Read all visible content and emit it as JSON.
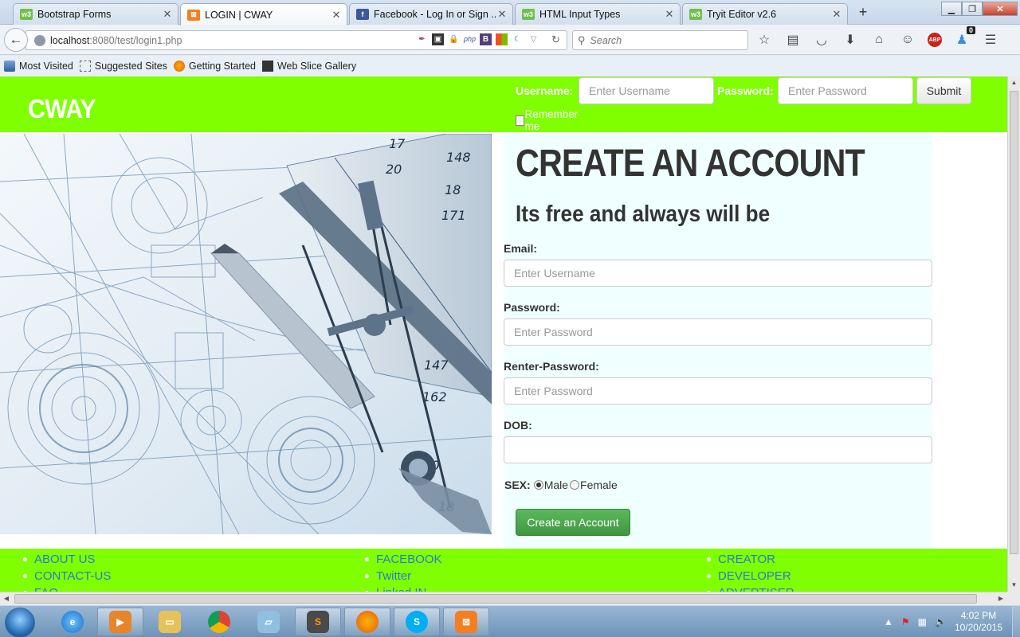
{
  "browser": {
    "tabs": [
      {
        "title": "Bootstrap Forms",
        "fav": "w3",
        "color": "#6ec04b",
        "active": false
      },
      {
        "title": "LOGIN | CWAY",
        "fav": "xampp",
        "color": "#f57e20",
        "active": true
      },
      {
        "title": "Facebook - Log In or Sign ...",
        "fav": "f",
        "color": "#3b5998",
        "active": false
      },
      {
        "title": "HTML Input Types",
        "fav": "w3",
        "color": "#6ec04b",
        "active": false
      },
      {
        "title": "Tryit Editor v2.6",
        "fav": "w3",
        "color": "#6ec04b",
        "active": false
      }
    ],
    "new_tab": "+",
    "url_host": "localhost",
    "url_rest": ":8080/test/login1.php",
    "search_placeholder": "Search",
    "bookmarks": [
      "Most Visited",
      "Suggested Sites",
      "Getting Started",
      "Web Slice Gallery"
    ],
    "notification_count": "0"
  },
  "site": {
    "logo": "CWAY",
    "login": {
      "username_label": "Username:",
      "username_placeholder": "Enter Username",
      "password_label": "Password:",
      "password_placeholder": "Enter Password",
      "submit_label": "Submit",
      "remember_label": "Remember me"
    },
    "signup": {
      "title": "CREATE AN ACCOUNT",
      "subtitle": "Its free and always will be",
      "email_label": "Email:",
      "email_placeholder": "Enter Username",
      "password_label": "Password:",
      "password_placeholder": "Enter Password",
      "repassword_label": "Renter-Password:",
      "repassword_placeholder": "Enter Password",
      "dob_label": "DOB:",
      "sex_label": "SEX:",
      "sex_options": [
        "Male",
        "Female"
      ],
      "sex_selected": "Male",
      "create_label": "Create an Account"
    },
    "footer": {
      "col1": [
        "ABOUT US",
        "CONTACT-US",
        "FAQ"
      ],
      "col2": [
        "FACEBOOK",
        "Twitter",
        "Linked IN"
      ],
      "col3": [
        "CREATOR",
        "DEVELOPER",
        "ADVERTISER"
      ]
    },
    "colors": {
      "header_green": "#7fff00",
      "panel_bg": "#f0ffff",
      "link_blue": "#2a7ad2",
      "create_green": "#5cb85c"
    }
  },
  "taskbar": {
    "time": "4:02 PM",
    "date": "10/20/2015"
  }
}
